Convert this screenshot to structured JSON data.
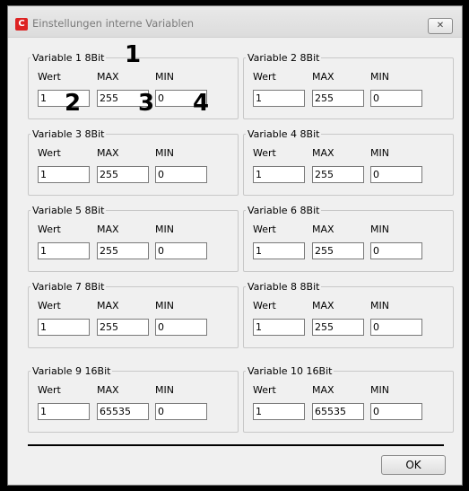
{
  "window": {
    "title": "Einstellungen interne Variablen",
    "close_icon": "✕"
  },
  "groups": [
    {
      "legend": "Variable 1 8Bit",
      "wert": "1",
      "max": "255",
      "min": "0"
    },
    {
      "legend": "Variable 2 8Bit",
      "wert": "1",
      "max": "255",
      "min": "0"
    },
    {
      "legend": "Variable 3 8Bit",
      "wert": "1",
      "max": "255",
      "min": "0"
    },
    {
      "legend": "Variable 4 8Bit",
      "wert": "1",
      "max": "255",
      "min": "0"
    },
    {
      "legend": "Variable 5 8Bit",
      "wert": "1",
      "max": "255",
      "min": "0"
    },
    {
      "legend": "Variable 6 8Bit",
      "wert": "1",
      "max": "255",
      "min": "0"
    },
    {
      "legend": "Variable 7 8Bit",
      "wert": "1",
      "max": "255",
      "min": "0"
    },
    {
      "legend": "Variable 8 8Bit",
      "wert": "1",
      "max": "255",
      "min": "0"
    },
    {
      "legend": "Variable 9 16Bit",
      "wert": "1",
      "max": "65535",
      "min": "0"
    },
    {
      "legend": "Variable 10 16Bit",
      "wert": "1",
      "max": "65535",
      "min": "0"
    }
  ],
  "labels": {
    "wert": "Wert",
    "max": "MAX",
    "min": "MIN"
  },
  "annotations": [
    "1",
    "2",
    "3",
    "4"
  ],
  "buttons": {
    "ok": "OK"
  }
}
